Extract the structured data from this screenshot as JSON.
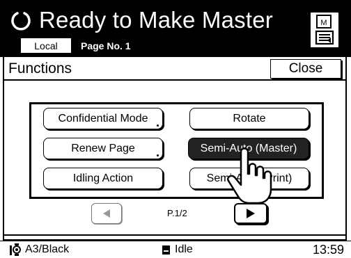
{
  "header": {
    "title": "Ready to Make Master",
    "mode_badge": "Local",
    "page_no": "Page No. 1",
    "icons": {
      "status": "ready-circle-icon",
      "master_button": "master-document-icon"
    }
  },
  "dialog": {
    "title": "Functions",
    "close_label": "Close"
  },
  "functions": {
    "left": [
      {
        "label": "Confidential Mode",
        "has_dot": true
      },
      {
        "label": "Renew Page",
        "has_dot": true
      },
      {
        "label": "Idling Action",
        "has_dot": false
      }
    ],
    "right": [
      {
        "label": "Rotate",
        "selected": false
      },
      {
        "label": "Semi-Auto (Master)",
        "selected": true
      },
      {
        "label": "Semi-Auto (Print)",
        "selected": false
      }
    ]
  },
  "pager": {
    "indicator": "P.1/2",
    "prev_icon": "triangle-left-icon",
    "next_icon": "triangle-right-icon"
  },
  "status_bar": {
    "paper": "A3/Black",
    "state": "Idle",
    "time": "13:59",
    "icons": {
      "paper": "ink-drum-icon",
      "state": "machine-status-icon"
    }
  },
  "colors": {
    "header_bg": "#000000",
    "selected_button_bg": "#222222",
    "disabled_arrow": "#999999"
  }
}
